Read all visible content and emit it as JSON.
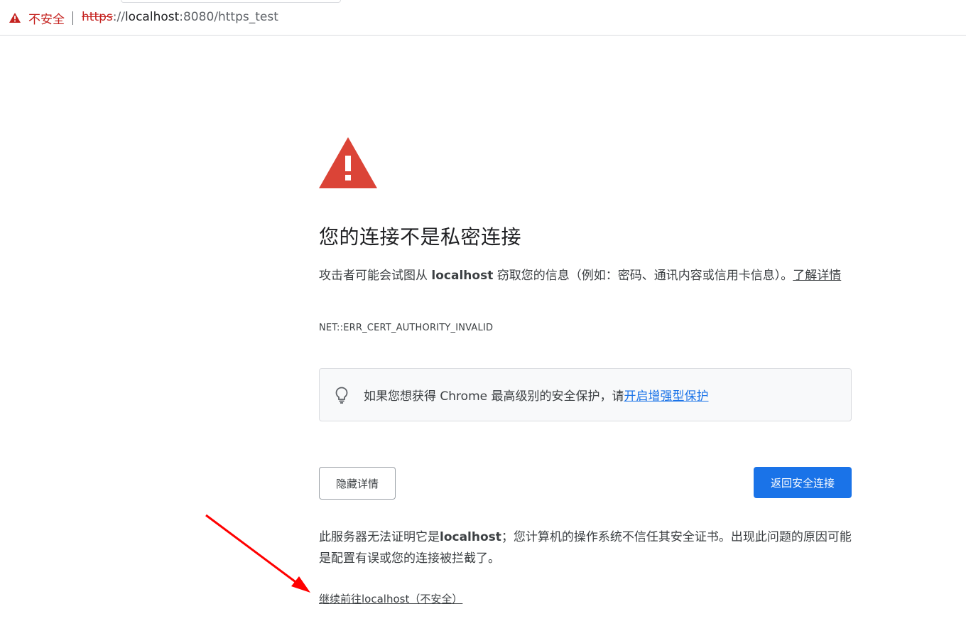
{
  "addressbar": {
    "security_label": "不安全",
    "url_scheme": "https",
    "url_sep": "://",
    "url_host": "localhost",
    "url_rest": ":8080/https_test"
  },
  "interstitial": {
    "heading": "您的连接不是私密连接",
    "explanation_prefix": "攻击者可能会试图从 ",
    "explanation_host": "localhost",
    "explanation_suffix": " 窃取您的信息（例如：密码、通讯内容或信用卡信息）。",
    "learn_more": "了解详情",
    "error_code": "NET::ERR_CERT_AUTHORITY_INVALID",
    "enhanced_text": "如果您想获得 Chrome 最高级别的安全保护，请",
    "enhanced_link": "开启增强型保护",
    "hide_details_button": "隐藏详情",
    "back_to_safety_button": "返回安全连接",
    "details_prefix": "此服务器无法证明它是",
    "details_host": "localhost",
    "details_suffix": "；您计算机的操作系统不信任其安全证书。出现此问题的原因可能是配置有误或您的连接被拦截了。",
    "proceed_link": "继续前往localhost（不安全）"
  },
  "colors": {
    "warning_red": "#db4437",
    "security_red": "#c5221f",
    "primary_blue": "#1a73e8",
    "annotation_arrow": "#ff0000"
  },
  "icons": {
    "security": "warning-triangle-icon",
    "page_warning": "warning-triangle-icon",
    "tip": "lightbulb-icon"
  }
}
